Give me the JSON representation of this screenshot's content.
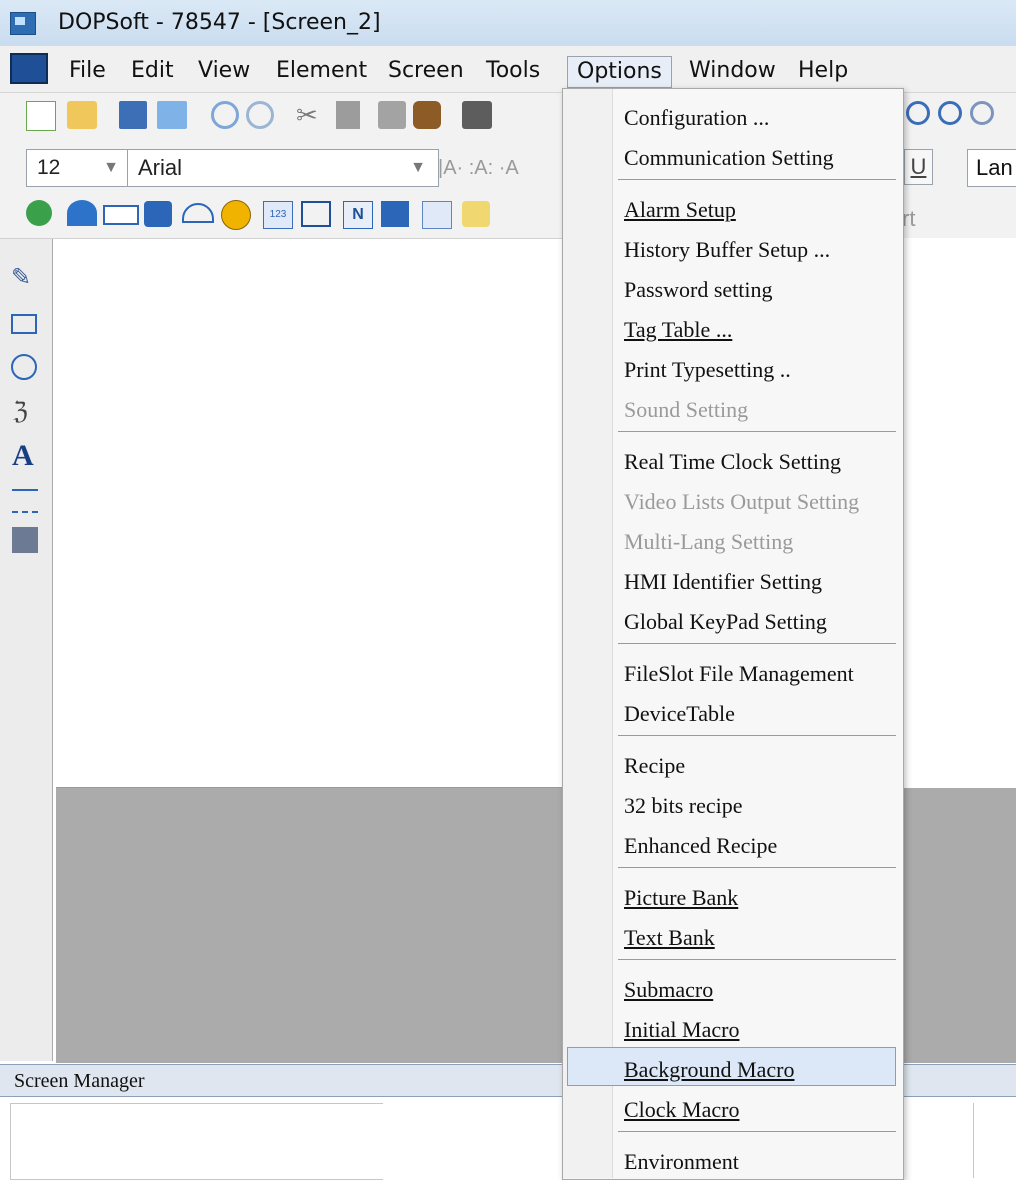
{
  "window": {
    "title": "DOPSoft - 78547 - [Screen_2]"
  },
  "menubar": {
    "items": [
      "File",
      "Edit",
      "View",
      "Element",
      "Screen",
      "Tools",
      "Options",
      "Window",
      "Help"
    ]
  },
  "format_toolbar": {
    "font_size": "12",
    "font_name": "Arial",
    "language_label": "Lan"
  },
  "screen_manager": {
    "label": "Screen Manager"
  },
  "options_menu": {
    "items": [
      {
        "label": "Configuration ...",
        "enabled": true
      },
      {
        "label": "Communication Setting",
        "enabled": true
      },
      {
        "label": "Alarm Setup",
        "enabled": true
      },
      {
        "label": "History Buffer Setup ...",
        "enabled": true
      },
      {
        "label": "Password setting",
        "enabled": true
      },
      {
        "label": "Tag Table ...",
        "enabled": true
      },
      {
        "label": "Print Typesetting ..",
        "enabled": true
      },
      {
        "label": "Sound Setting",
        "enabled": false
      },
      {
        "label": "Real Time Clock Setting",
        "enabled": true
      },
      {
        "label": "Video Lists Output Setting",
        "enabled": false
      },
      {
        "label": "Multi-Lang Setting",
        "enabled": false
      },
      {
        "label": "HMI Identifier Setting",
        "enabled": true
      },
      {
        "label": "Global KeyPad Setting",
        "enabled": true
      },
      {
        "label": "FileSlot File Management",
        "enabled": true
      },
      {
        "label": "DeviceTable",
        "enabled": true
      },
      {
        "label": "Recipe",
        "enabled": true
      },
      {
        "label": "32 bits recipe",
        "enabled": true
      },
      {
        "label": "Enhanced Recipe",
        "enabled": true
      },
      {
        "label": "Picture Bank",
        "enabled": true
      },
      {
        "label": "Text Bank",
        "enabled": true
      },
      {
        "label": "Submacro",
        "enabled": true
      },
      {
        "label": "Initial Macro",
        "enabled": true
      },
      {
        "label": "Background Macro",
        "enabled": true
      },
      {
        "label": "Clock Macro",
        "enabled": true
      },
      {
        "label": "Environment",
        "enabled": true
      }
    ]
  },
  "icons": {
    "app": "app-icon",
    "new": "new-file-icon",
    "open": "open-folder-icon",
    "save": "save-icon",
    "undo": "undo-icon",
    "redo": "redo-icon",
    "cut": "cut-icon",
    "copy": "copy-icon",
    "paste": "paste-icon",
    "find": "find-icon",
    "zoom_in": "zoom-in-icon",
    "zoom_out": "zoom-out-icon"
  }
}
